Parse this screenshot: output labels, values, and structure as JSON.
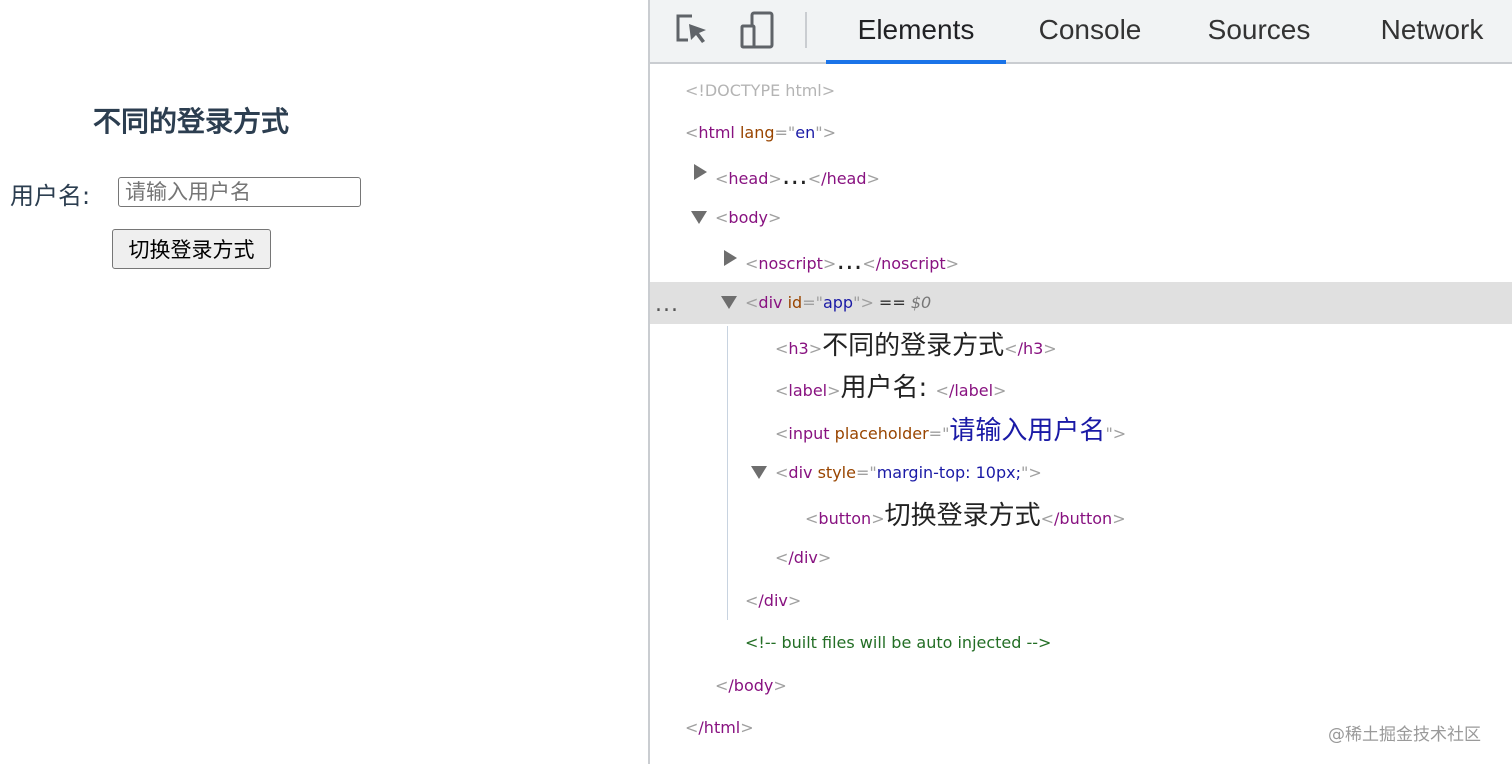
{
  "page": {
    "title": "不同的登录方式",
    "username_label": "用户名:",
    "username_placeholder": "请输入用户名",
    "switch_button": "切换登录方式"
  },
  "devtools": {
    "tabs": [
      "Elements",
      "Console",
      "Sources",
      "Network"
    ],
    "active_tab": "Elements",
    "icons": [
      "inspect-element-icon",
      "device-toolbar-icon"
    ],
    "selected_row_marker": "...",
    "tree": {
      "doctype": "<!DOCTYPE html>",
      "html_open": {
        "tag": "html",
        "attr_name": "lang",
        "attr_value": "en"
      },
      "head": {
        "open": "head",
        "ellipsis": "…",
        "close": "/head"
      },
      "body_open": "body",
      "noscript": {
        "open": "noscript",
        "ellipsis": "…",
        "close": "/noscript"
      },
      "div_app": {
        "tag": "div",
        "attr_name": "id",
        "attr_value": "app",
        "eq": " == ",
        "selected_var": "$0"
      },
      "h3": {
        "open": "h3",
        "text": "不同的登录方式",
        "close": "/h3"
      },
      "label": {
        "open": "label",
        "text": "用户名: ",
        "close": "/label"
      },
      "input": {
        "tag": "input",
        "attr_name": "placeholder",
        "attr_value": "请输入用户名"
      },
      "div_style": {
        "tag": "div",
        "attr_name": "style",
        "attr_value": "margin-top: 10px;"
      },
      "button": {
        "open": "button",
        "text": "切换登录方式",
        "close": "/button"
      },
      "div_close_inner": "/div",
      "div_close_app": "/div",
      "comment": "<!-- built files will be auto injected -->",
      "body_close": "/body",
      "html_close": "/html"
    }
  },
  "watermark": "@稀土掘金技术社区",
  "colors": {
    "tag": "#881280",
    "attr_name": "#994500",
    "attr_value": "#1a1aa6",
    "comment": "#236e25",
    "active_tab_underline": "#1a73e8",
    "selected_row": "#e0e0e0"
  }
}
